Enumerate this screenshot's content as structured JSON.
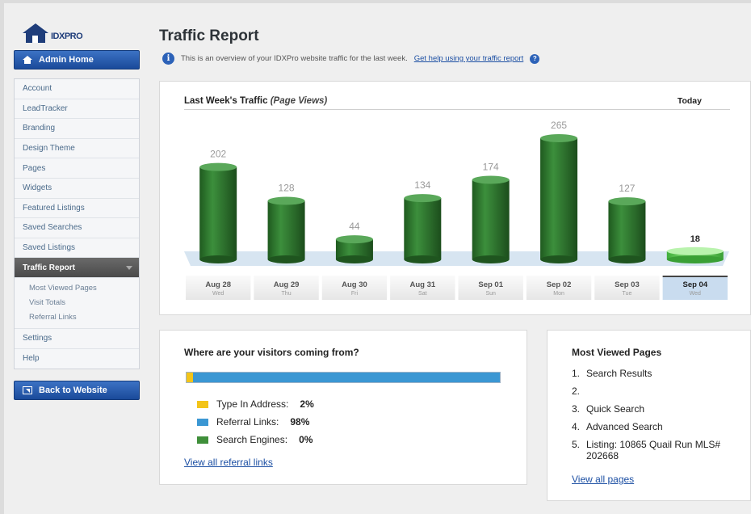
{
  "logo": {
    "brand": "IDXPRO"
  },
  "sidebar": {
    "admin_home": "Admin Home",
    "back_to_website": "Back to Website",
    "items": [
      {
        "label": "Account"
      },
      {
        "label": "LeadTracker"
      },
      {
        "label": "Branding"
      },
      {
        "label": "Design Theme"
      },
      {
        "label": "Pages"
      },
      {
        "label": "Widgets"
      },
      {
        "label": "Featured Listings"
      },
      {
        "label": "Saved Searches"
      },
      {
        "label": "Saved Listings"
      }
    ],
    "active_item": "Traffic Report",
    "sub_items": [
      {
        "label": "Most Viewed Pages"
      },
      {
        "label": "Visit Totals"
      },
      {
        "label": "Referral Links"
      }
    ],
    "bottom_items": [
      {
        "label": "Settings"
      },
      {
        "label": "Help"
      }
    ]
  },
  "header": {
    "title": "Traffic Report",
    "intro": "This is an overview of your IDXPro website traffic for the last week.",
    "help_link": "Get help using your traffic report"
  },
  "chart_panel": {
    "title": "Last Week's Traffic",
    "subtitle": "(Page Views)",
    "today_label": "Today"
  },
  "chart_data": {
    "type": "bar",
    "categories": [
      "Aug 28",
      "Aug 29",
      "Aug 30",
      "Aug 31",
      "Sep 01",
      "Sep 02",
      "Sep 03",
      "Sep 04"
    ],
    "weekdays": [
      "Wed",
      "Thu",
      "Fri",
      "Sat",
      "Sun",
      "Mon",
      "Tue",
      "Wed"
    ],
    "values": [
      202,
      128,
      44,
      134,
      174,
      265,
      127,
      18
    ],
    "highlight_index": 7,
    "ylim": [
      0,
      265
    ],
    "colors": {
      "bar": "#2f7a2f",
      "today_bar": "#5fcc4f",
      "today_bg": "#c9dcef"
    }
  },
  "sources": {
    "heading": "Where are your visitors coming from?",
    "items": [
      {
        "label": "Type In Address:",
        "value": "2%",
        "percent": 2,
        "color": "#f3c419"
      },
      {
        "label": "Referral Links:",
        "value": "98%",
        "percent": 98,
        "color": "#3b97d3"
      },
      {
        "label": "Search Engines:",
        "value": "0%",
        "percent": 0,
        "color": "#3f8f3a"
      }
    ],
    "link": "View all referral links"
  },
  "most_viewed": {
    "heading": "Most Viewed Pages",
    "items": [
      {
        "num": "1.",
        "label": "Search Results"
      },
      {
        "num": "2.",
        "label": ""
      },
      {
        "num": "3.",
        "label": "Quick Search"
      },
      {
        "num": "4.",
        "label": "Advanced Search"
      },
      {
        "num": "5.",
        "label": "Listing: 10865 Quail Run MLS# 202668"
      }
    ],
    "link": "View all pages"
  }
}
